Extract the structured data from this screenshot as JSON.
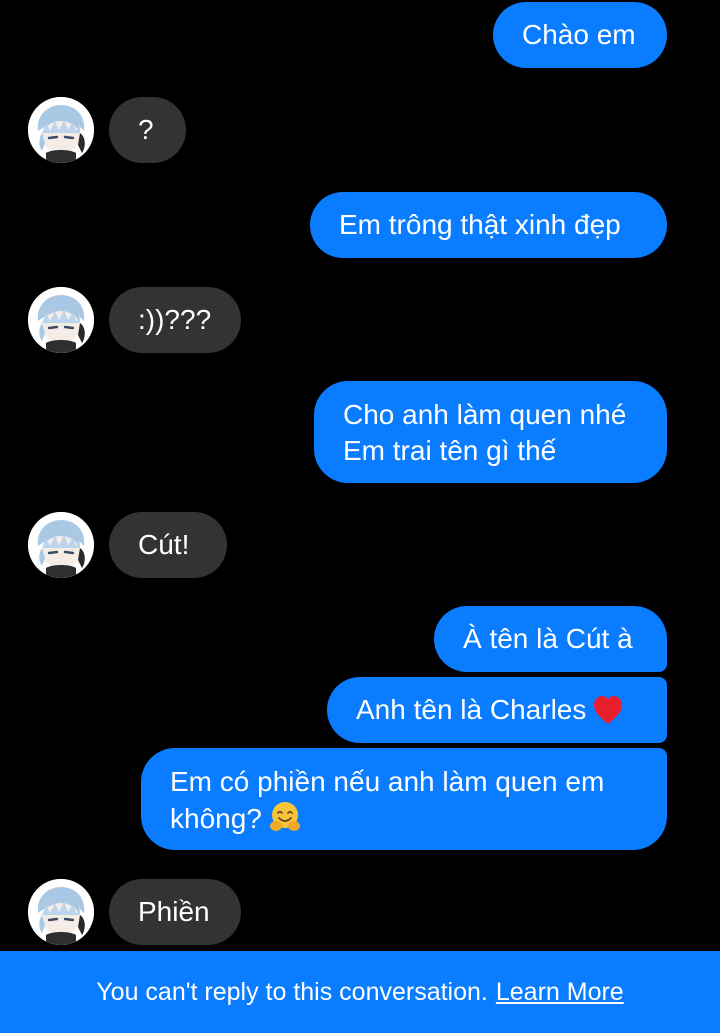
{
  "conversation": {
    "messages": [
      {
        "id": "m1",
        "side": "sent",
        "text": "Chào em"
      },
      {
        "id": "m2",
        "side": "received",
        "text": "?"
      },
      {
        "id": "m3",
        "side": "sent",
        "text": "Em trông thật xinh đẹp"
      },
      {
        "id": "m4",
        "side": "received",
        "text": ":))???"
      },
      {
        "id": "m5",
        "side": "sent",
        "lines": [
          "Cho anh làm quen nhé",
          "Em trai tên gì thế"
        ]
      },
      {
        "id": "m6",
        "side": "received",
        "text": "Cút!"
      },
      {
        "id": "m7",
        "side": "sent",
        "text": "À tên là Cút à"
      },
      {
        "id": "m8",
        "side": "sent",
        "text": "Anh tên là Charles",
        "emoji": "red-heart-icon"
      },
      {
        "id": "m9",
        "side": "sent",
        "lines": [
          "Em có phiền nếu anh làm quen em",
          "không?"
        ],
        "emoji": "hugging-face-icon"
      },
      {
        "id": "m10",
        "side": "received",
        "text": "Phiền"
      }
    ]
  },
  "footer": {
    "notice": "You can't reply to this conversation.",
    "link": "Learn More"
  },
  "colors": {
    "background": "#000000",
    "sent_bubble": "#0a7cff",
    "received_bubble": "#333333",
    "footer": "#0a7cff",
    "text": "#ffffff"
  }
}
